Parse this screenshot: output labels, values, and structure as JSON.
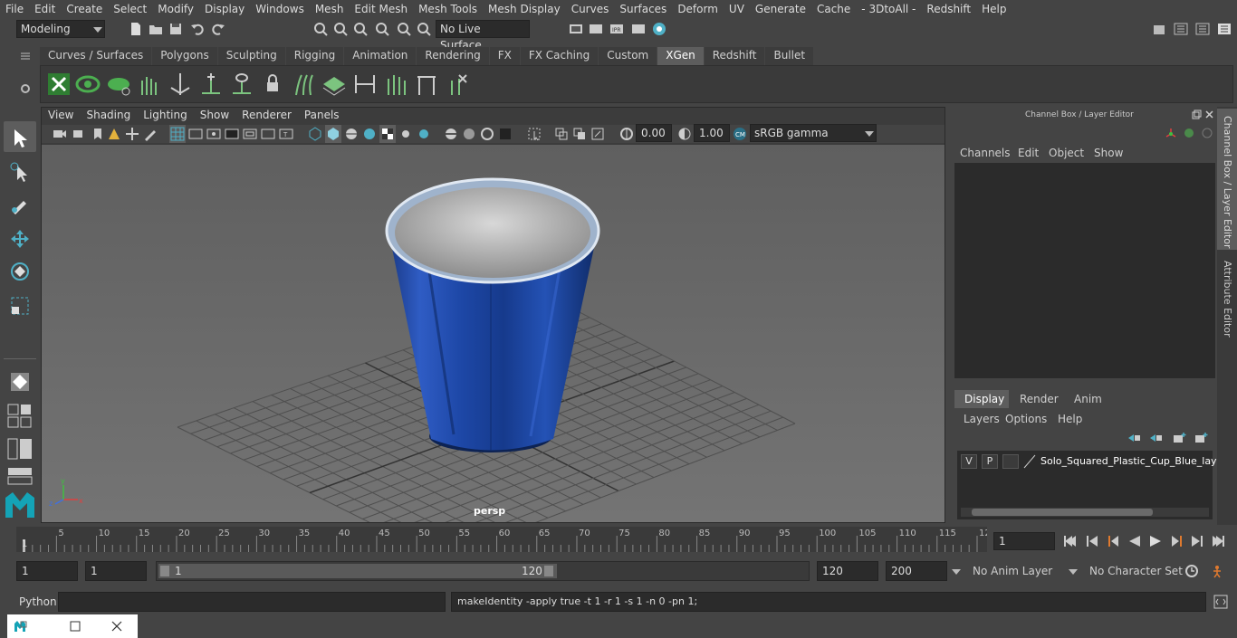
{
  "menubar": [
    "File",
    "Edit",
    "Create",
    "Select",
    "Modify",
    "Display",
    "Windows",
    "Mesh",
    "Edit Mesh",
    "Mesh Tools",
    "Mesh Display",
    "Curves",
    "Surfaces",
    "Deform",
    "UV",
    "Generate",
    "Cache",
    "- 3DtoAll -",
    "Redshift",
    "Help"
  ],
  "toolbar": {
    "mode": "Modeling",
    "live_surface": "No Live Surface"
  },
  "shelf_tabs": [
    "Curves / Surfaces",
    "Polygons",
    "Sculpting",
    "Rigging",
    "Animation",
    "Rendering",
    "FX",
    "FX Caching",
    "Custom",
    "XGen",
    "Redshift",
    "Bullet"
  ],
  "shelf_active": "XGen",
  "viewport": {
    "menu": [
      "View",
      "Shading",
      "Lighting",
      "Show",
      "Renderer",
      "Panels"
    ],
    "exposure": "0.00",
    "gamma": "1.00",
    "color_space": "sRGB gamma",
    "camera_label": "persp"
  },
  "channel_box": {
    "title": "Channel Box / Layer Editor",
    "menu": [
      "Channels",
      "Edit",
      "Object",
      "Show"
    ]
  },
  "layer_editor": {
    "tabs": [
      "Display",
      "Render",
      "Anim"
    ],
    "active_tab": "Display",
    "menu": [
      "Layers",
      "Options",
      "Help"
    ],
    "layer": {
      "v": "V",
      "p": "P",
      "name": "Solo_Squared_Plastic_Cup_Blue_layer"
    }
  },
  "side_tabs": [
    "Channel Box / Layer Editor",
    "Attribute Editor"
  ],
  "timeline": {
    "ticks": [
      "5",
      "10",
      "15",
      "20",
      "25",
      "30",
      "35",
      "40",
      "45",
      "50",
      "55",
      "60",
      "65",
      "70",
      "75",
      "80",
      "85",
      "90",
      "95",
      "100",
      "105",
      "110",
      "115",
      "12"
    ],
    "start_label": "1",
    "current_frame": "1"
  },
  "range": {
    "start": "1",
    "playback_start": "1",
    "slider_start": "1",
    "slider_end": "120",
    "playback_end": "120",
    "end": "200",
    "anim_layer": "No Anim Layer",
    "character_set": "No Character Set"
  },
  "command": {
    "language": "Python",
    "output": "makeIdentity -apply true -t 1 -r 1 -s 1 -n 0 -pn 1;"
  },
  "colors": {
    "cup_blue": "#1e3f8c",
    "active_tab": "#5d5d5d",
    "accent": "#4fb0c6"
  }
}
